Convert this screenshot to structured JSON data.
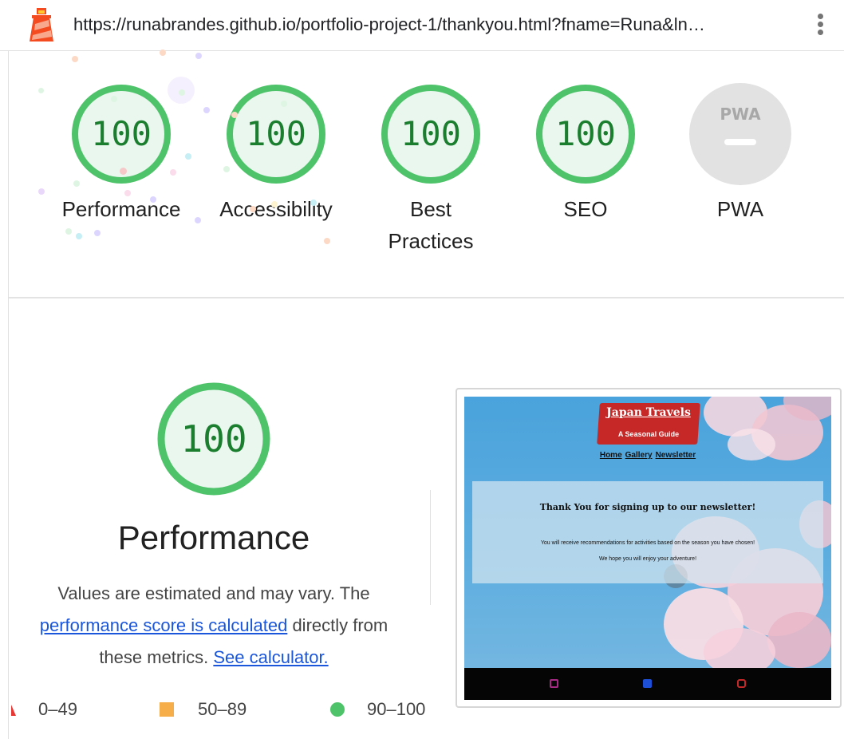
{
  "topbar": {
    "url": "https://runabrandes.github.io/portfolio-project-1/thankyou.html?fname=Runa&ln…",
    "logo_icon": "lighthouse-icon",
    "menu_icon": "more-vertical-icon"
  },
  "gauges": [
    {
      "label": "Performance",
      "score": "100"
    },
    {
      "label": "Accessibility",
      "score": "100"
    },
    {
      "label": "Best Practices",
      "score": "100"
    },
    {
      "label": "SEO",
      "score": "100"
    },
    {
      "label": "PWA",
      "score": "PWA"
    }
  ],
  "performance": {
    "score": "100",
    "title": "Performance",
    "desc_prefix": "Values are estimated and may vary. The ",
    "link_calc": "performance score is calculated",
    "desc_middle": " directly from these metrics. ",
    "link_calculator": "See calculator."
  },
  "legend": {
    "fail": "0–49",
    "average": "50–89",
    "pass": "90–100"
  },
  "screenshot": {
    "brand_title": "Japan Travels",
    "brand_subtitle": "A Seasonal Guide",
    "nav": [
      "Home",
      "Gallery",
      "Newsletter"
    ],
    "heading": "Thank You for signing up to our newsletter!",
    "line1": "You will receive recommendations for activities based on the season you have chosen!",
    "line2": "We hope you will enjoy your adventure!"
  },
  "colors": {
    "pass": "#0cce6b",
    "pass_text": "#1b7e2f",
    "average": "#ffa400",
    "fail": "#ff4e42",
    "pwa_gray": "#e2e2e2",
    "link": "#1a56db"
  }
}
